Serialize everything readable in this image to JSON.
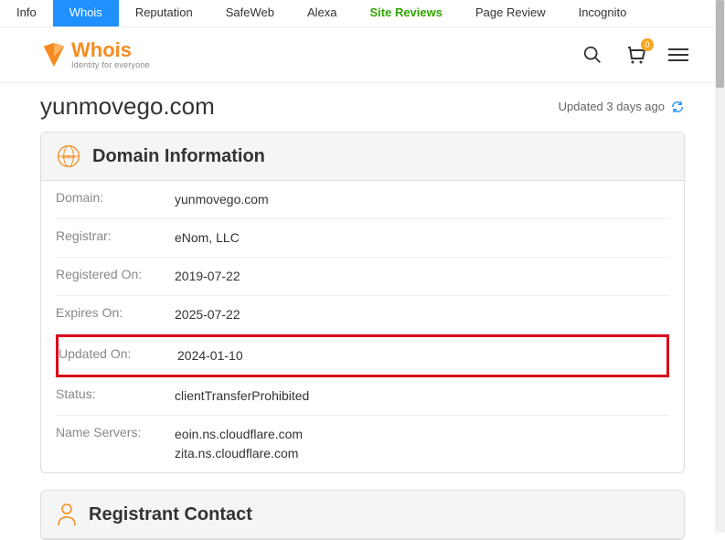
{
  "topnav": {
    "items": [
      "Info",
      "Whois",
      "Reputation",
      "SafeWeb",
      "Alexa",
      "Site Reviews",
      "Page Review",
      "Incognito"
    ],
    "active_index": 1,
    "green_index": 5
  },
  "header": {
    "logo_text": "Whois",
    "logo_sub": "Identity for everyone",
    "cart_badge": "0"
  },
  "page": {
    "domain": "yunmovego.com",
    "updated_text": "Updated 3 days ago"
  },
  "domain_info": {
    "title": "Domain Information",
    "rows": [
      {
        "label": "Domain:",
        "value": "yunmovego.com"
      },
      {
        "label": "Registrar:",
        "value": "eNom, LLC"
      },
      {
        "label": "Registered On:",
        "value": "2019-07-22"
      },
      {
        "label": "Expires On:",
        "value": "2025-07-22"
      },
      {
        "label": "Updated On:",
        "value": "2024-01-10"
      },
      {
        "label": "Status:",
        "value": "clientTransferProhibited"
      },
      {
        "label": "Name Servers:",
        "value": "eoin.ns.cloudflare.com\nzita.ns.cloudflare.com"
      }
    ],
    "highlight_row_index": 4
  },
  "registrant": {
    "title": "Registrant Contact"
  }
}
